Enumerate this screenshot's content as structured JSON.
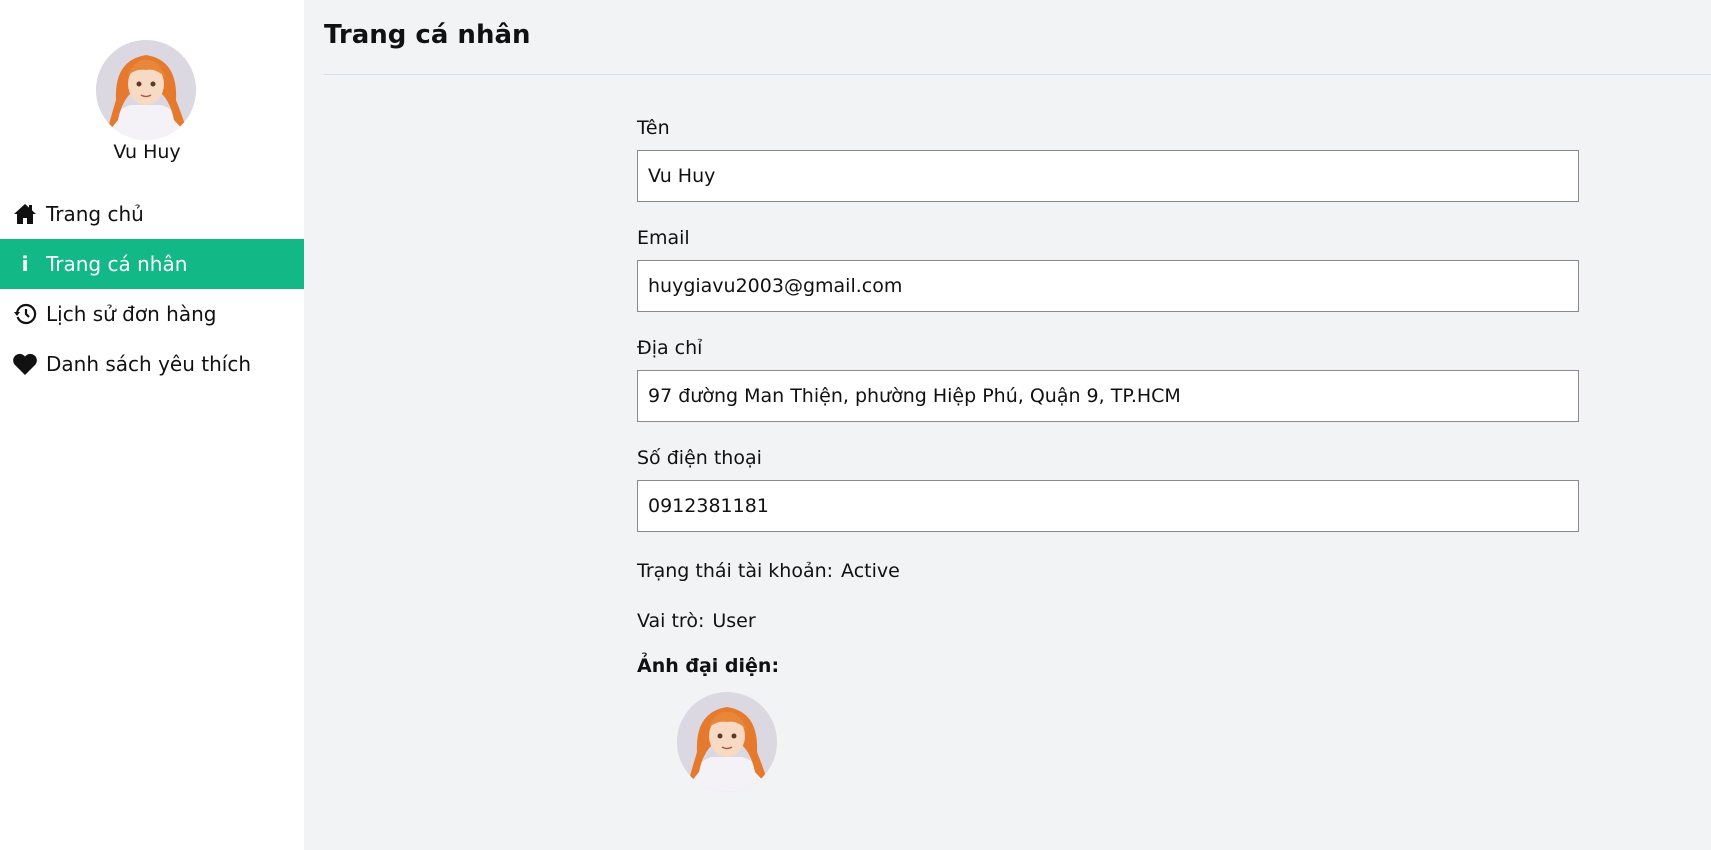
{
  "sidebar": {
    "user_name": "Vu Huy",
    "items": [
      {
        "label": "Trang chủ",
        "icon": "home-icon",
        "active": false
      },
      {
        "label": "Trang cá nhân",
        "icon": "info-icon",
        "active": true
      },
      {
        "label": "Lịch sử đơn hàng",
        "icon": "history-icon",
        "active": false
      },
      {
        "label": "Danh sách yêu thích",
        "icon": "heart-icon",
        "active": false
      }
    ],
    "active_color": "#12b886"
  },
  "main": {
    "title": "Trang cá nhân",
    "fields": {
      "name": {
        "label": "Tên",
        "value": "Vu Huy"
      },
      "email": {
        "label": "Email",
        "value": "huygiavu2003@gmail.com"
      },
      "address": {
        "label": "Địa chỉ",
        "value": "97 đường Man Thiện, phường Hiệp Phú, Quận 9, TP.HCM"
      },
      "phone": {
        "label": "Số điện thoại",
        "value": "0912381181"
      }
    },
    "status": {
      "label": "Trạng thái tài khoản:",
      "value": "Active"
    },
    "role": {
      "label": "Vai trò:",
      "value": "User"
    },
    "avatar_label": "Ảnh đại diện:"
  }
}
